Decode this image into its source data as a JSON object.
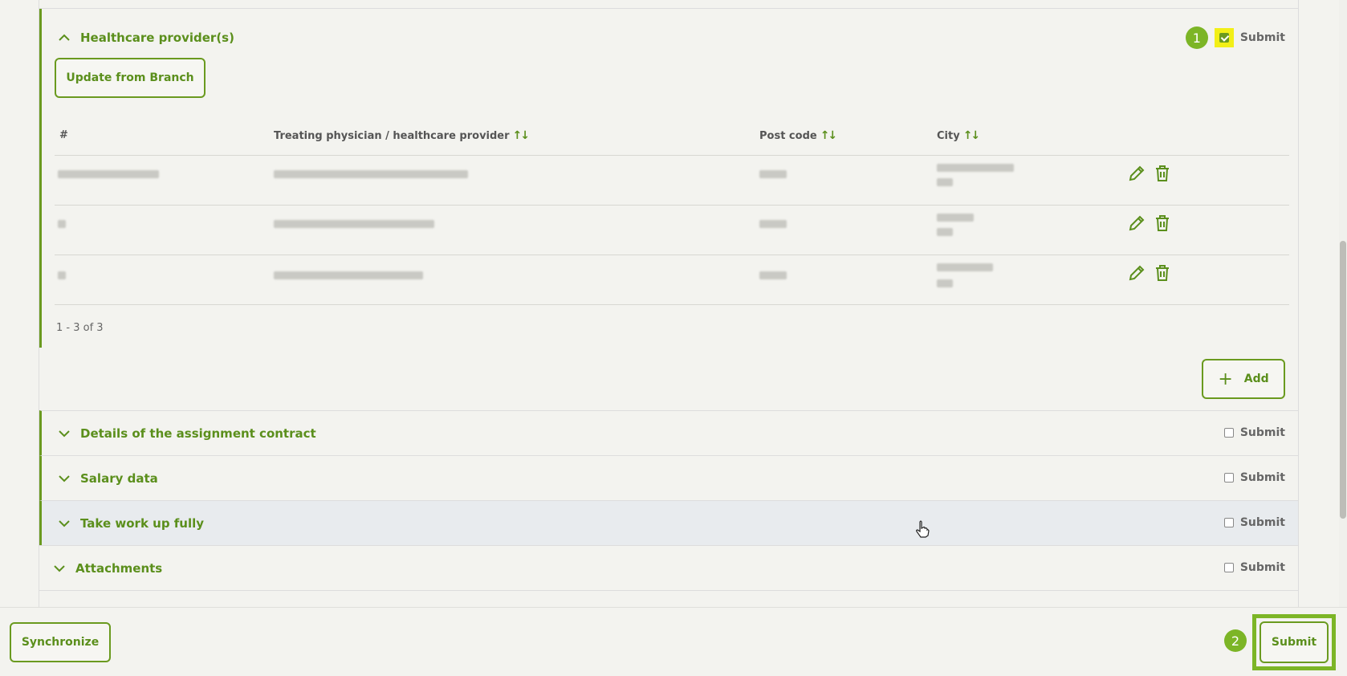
{
  "healthcare": {
    "title": "Healthcare provider(s)",
    "submit_label": "Submit",
    "badge": "1",
    "update_button": "Update from Branch",
    "columns": {
      "num": "#",
      "provider": "Treating physician / healthcare provider",
      "postcode": "Post code",
      "city": "City"
    },
    "count_text": "1 - 3 of 3",
    "add_button": "Add"
  },
  "sections": [
    {
      "title": "Details of the assignment contract",
      "submit_label": "Submit"
    },
    {
      "title": "Salary data",
      "submit_label": "Submit"
    },
    {
      "title": "Take work up fully",
      "submit_label": "Submit"
    },
    {
      "title": "Attachments",
      "submit_label": "Submit"
    }
  ],
  "footer": {
    "sync_button": "Synchronize",
    "submit_button": "Submit",
    "badge": "2"
  },
  "colors": {
    "accent": "#6a9a1f",
    "highlight": "#f2ef17",
    "badge": "#7cb526"
  }
}
